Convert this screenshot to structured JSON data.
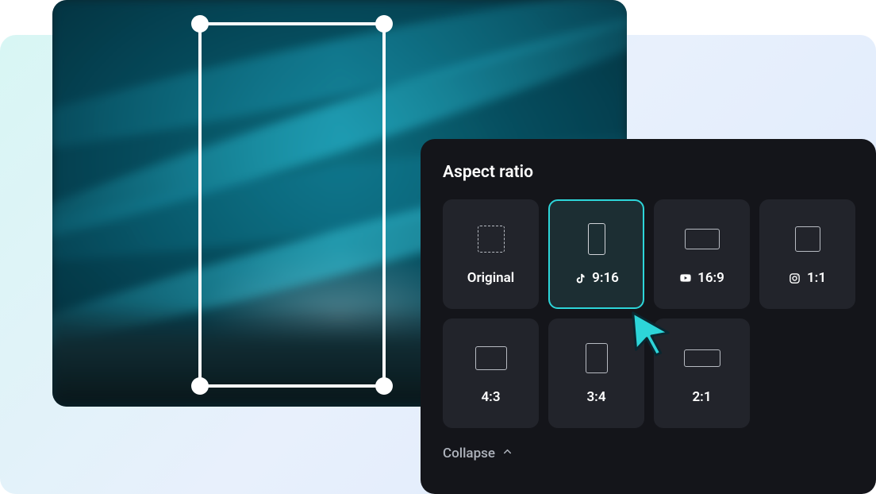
{
  "panel": {
    "title": "Aspect ratio",
    "collapse_label": "Collapse",
    "selected": "9:16",
    "ratios": [
      {
        "label": "Original",
        "shape": "dashed",
        "brand": null
      },
      {
        "label": "9:16",
        "shape": "916",
        "brand": "tiktok"
      },
      {
        "label": "16:9",
        "shape": "169",
        "brand": "youtube"
      },
      {
        "label": "1:1",
        "shape": "11",
        "brand": "instagram"
      },
      {
        "label": "4:3",
        "shape": "43",
        "brand": null
      },
      {
        "label": "3:4",
        "shape": "34",
        "brand": null
      },
      {
        "label": "2:1",
        "shape": "21",
        "brand": null
      }
    ]
  },
  "colors": {
    "accent": "#2dd5d9",
    "panel_bg": "#14151a",
    "tile_bg": "#22242b"
  }
}
